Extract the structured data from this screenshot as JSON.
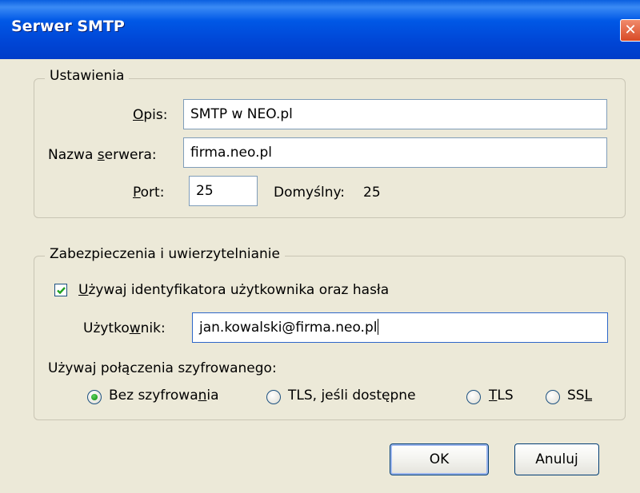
{
  "window": {
    "title": "Serwer SMTP"
  },
  "settings": {
    "legend": "Ustawienia",
    "description_label": "Opis:",
    "description_value": "SMTP w NEO.pl",
    "server_label": "Nazwa serwera:",
    "server_value": "firma.neo.pl",
    "port_label": "Port:",
    "port_value": "25",
    "default_label": "Domyślny:",
    "default_value": "25"
  },
  "security": {
    "legend": "Zabezpieczenia i uwierzytelnianie",
    "use_auth_label": "Używaj identyfikatora użytkownika oraz hasła",
    "use_auth_checked": true,
    "user_label": "Użytkownik:",
    "user_value": "jan.kowalski@firma.neo.pl",
    "encryption_label": "Używaj połączenia szyfrowanego:",
    "options": [
      {
        "label": "Bez szyfrowania",
        "selected": true
      },
      {
        "label": "TLS, jeśli dostępne",
        "selected": false
      },
      {
        "label": "TLS",
        "selected": false
      },
      {
        "label": "SSL",
        "selected": false
      }
    ]
  },
  "buttons": {
    "ok": "OK",
    "cancel": "Anuluj"
  },
  "colors": {
    "titlebar": "#0054e3",
    "dialog_bg": "#ece9d8",
    "radio_selected": "#21a121",
    "check": "#21a121"
  }
}
